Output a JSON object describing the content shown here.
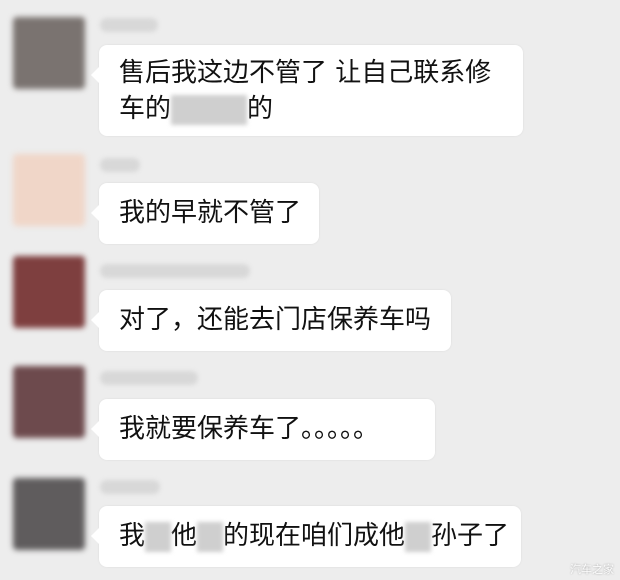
{
  "messages": [
    {
      "lines": [
        {
          "parts": [
            {
              "text": "售后我这边不管了 让自己联系修"
            }
          ]
        },
        {
          "parts": [
            {
              "text": "车的"
            },
            {
              "redacted": true,
              "w": 76
            },
            {
              "text": "的"
            }
          ]
        }
      ],
      "avatar_color": "#7a7370"
    },
    {
      "lines": [
        {
          "parts": [
            {
              "text": "我的早就不管了"
            }
          ]
        }
      ],
      "avatar_color": "#f0d6c8"
    },
    {
      "lines": [
        {
          "parts": [
            {
              "text": "对了，还能去门店保养车吗"
            }
          ]
        }
      ],
      "avatar_color": "#7e3f3f"
    },
    {
      "lines": [
        {
          "parts": [
            {
              "text": "我就要保养车了。。。。。"
            }
          ]
        }
      ],
      "avatar_color": "#6d4a4d"
    },
    {
      "lines": [
        {
          "parts": [
            {
              "text": "我"
            },
            {
              "redacted": true,
              "w": 26
            },
            {
              "text": "他"
            },
            {
              "redacted": true,
              "w": 26
            },
            {
              "text": "的现在咱们成他"
            },
            {
              "redacted": true,
              "w": 26
            },
            {
              "text": "孙子了"
            }
          ]
        }
      ],
      "avatar_color": "#5f5c5d"
    }
  ],
  "watermark": "汽车之家"
}
